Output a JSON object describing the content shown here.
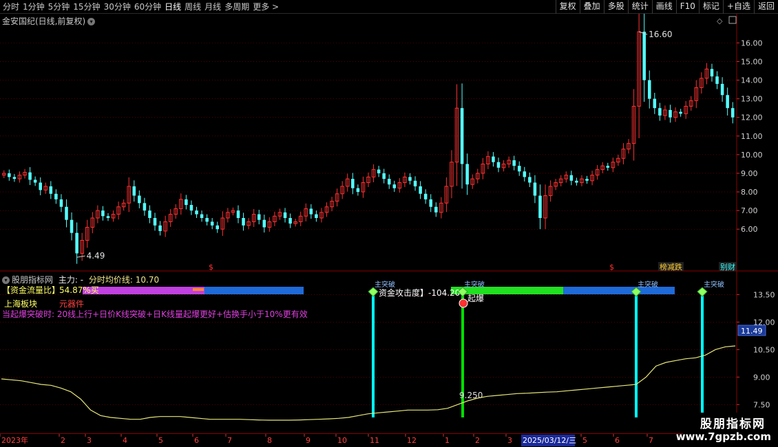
{
  "toolbar": {
    "periods": [
      "分时",
      "1分钟",
      "5分钟",
      "15分钟",
      "30分钟",
      "60分钟",
      "日线",
      "周线",
      "月线",
      "多周期",
      "更多 >"
    ],
    "active_period": "日线",
    "right_buttons": [
      "复权",
      "叠加",
      "多股",
      "统计",
      "画线",
      "F10",
      "标记",
      "+自选",
      "返回"
    ]
  },
  "main_panel": {
    "title": "金安国纪(日线,前复权)",
    "high_label": "16.60",
    "low_label": "4.49",
    "markers": [
      "$",
      "$",
      "榜减跌",
      "别财"
    ]
  },
  "sub_panel": {
    "title_name": "股朋指标网",
    "title_main": "主力: -",
    "title_avg": "分时均价线: 10.70",
    "fund_ratio_label": "【资金流量比】",
    "fund_ratio_value": "54.87%买",
    "board_label": "上海板块",
    "board_sector": "元器件",
    "condition_text": "当起爆突破时: 20线上行+日价K线突破+日K线量起爆更好+估换手小于10%更有效",
    "attack_label": "资金攻击度】",
    "attack_value": "-104.20",
    "qibao_label": "起爆",
    "signal_labels": [
      "主突破",
      "主突破",
      "主突破",
      "主突破"
    ],
    "point_label": "9.250",
    "current_value": "11.49"
  },
  "date_axis": {
    "labels": [
      "2023年",
      "2",
      "3",
      "4",
      "5",
      "6",
      "7",
      "8",
      "9",
      "10",
      "11",
      "12",
      "1",
      "2",
      "3",
      "2025/03/12/三",
      "5",
      "6",
      "7"
    ]
  },
  "watermark": {
    "name": "股朋指标网",
    "url": "www.7gpzb.com"
  },
  "colors": {
    "up": "#ff3232",
    "down": "#54ffff",
    "grid": "#8b0000",
    "avg_line": "#e8e87a",
    "signal": "#00ffff",
    "green_signal": "#00e000",
    "bar_blue": "#1e6ad8",
    "bar_purple": "#c040e0",
    "bar_green": "#20e020"
  },
  "chart_data": {
    "type": "candlestick",
    "title": "金安国纪(日线,前复权)",
    "y_ticks": [
      6.0,
      7.0,
      8.0,
      9.0,
      10.0,
      11.0,
      12.0,
      13.0,
      14.0,
      15.0,
      16.0
    ],
    "ylim": [
      4.2,
      16.9
    ],
    "max_label": 16.6,
    "min_label": 4.49,
    "closes": [
      9.0,
      8.8,
      8.7,
      8.9,
      9.05,
      8.65,
      8.5,
      8.1,
      8.3,
      7.9,
      7.6,
      7.2,
      6.5,
      5.8,
      4.7,
      5.4,
      6.1,
      6.6,
      7.0,
      6.7,
      6.6,
      6.8,
      7.2,
      7.4,
      8.3,
      7.8,
      7.4,
      7.0,
      6.6,
      6.2,
      5.9,
      6.4,
      6.8,
      7.1,
      7.6,
      7.3,
      7.0,
      6.8,
      6.6,
      6.4,
      6.2,
      6.0,
      6.6,
      6.9,
      7.0,
      6.6,
      6.2,
      6.4,
      6.8,
      6.5,
      6.1,
      6.4,
      6.7,
      6.9,
      6.6,
      6.3,
      6.4,
      6.7,
      7.1,
      6.8,
      6.6,
      6.9,
      7.2,
      7.5,
      7.9,
      8.3,
      8.7,
      8.2,
      8.0,
      8.5,
      8.8,
      9.2,
      9.0,
      8.7,
      8.4,
      8.2,
      8.5,
      8.8,
      8.6,
      8.3,
      7.9,
      7.6,
      7.2,
      6.9,
      7.4,
      8.3,
      9.6,
      12.5,
      9.5,
      8.4,
      8.7,
      9.0,
      9.5,
      9.9,
      9.6,
      9.3,
      9.5,
      9.7,
      9.4,
      9.1,
      8.8,
      8.5,
      7.8,
      6.6,
      7.8,
      8.3,
      8.5,
      8.7,
      8.9,
      8.6,
      8.5,
      8.7,
      8.6,
      8.9,
      9.2,
      9.4,
      9.3,
      9.6,
      9.8,
      10.3,
      10.6,
      12.6,
      16.6,
      14.0,
      13.0,
      12.5,
      12.1,
      12.4,
      12.0,
      12.3,
      12.2,
      12.6,
      12.9,
      13.6,
      14.1,
      14.6,
      14.2,
      13.8,
      13.2,
      12.5,
      12.0
    ],
    "sub_panel_ticks": [
      7.5,
      9.0,
      10.5,
      12.0,
      13.5
    ],
    "sub_panel_ylim": [
      6.8,
      14.0
    ],
    "avg_line": [
      8.9,
      8.85,
      8.8,
      8.7,
      8.6,
      8.55,
      8.4,
      8.2,
      7.8,
      7.2,
      6.9,
      6.8,
      6.75,
      6.7,
      6.7,
      6.8,
      6.85,
      6.85,
      6.85,
      6.8,
      6.75,
      6.7,
      6.7,
      6.7,
      6.7,
      6.68,
      6.66,
      6.65,
      6.65,
      6.65,
      6.66,
      6.68,
      6.7,
      6.72,
      6.75,
      6.8,
      6.9,
      7.0,
      7.05,
      7.1,
      7.15,
      7.2,
      7.2,
      7.2,
      7.22,
      7.3,
      7.5,
      7.7,
      7.85,
      7.95,
      8.0,
      8.05,
      8.1,
      8.12,
      8.15,
      8.18,
      8.2,
      8.25,
      8.3,
      8.35,
      8.4,
      8.45,
      8.5,
      8.55,
      8.6,
      9.0,
      9.6,
      9.8,
      9.9,
      10.0,
      10.05,
      10.2,
      10.5,
      10.65,
      10.7
    ]
  }
}
